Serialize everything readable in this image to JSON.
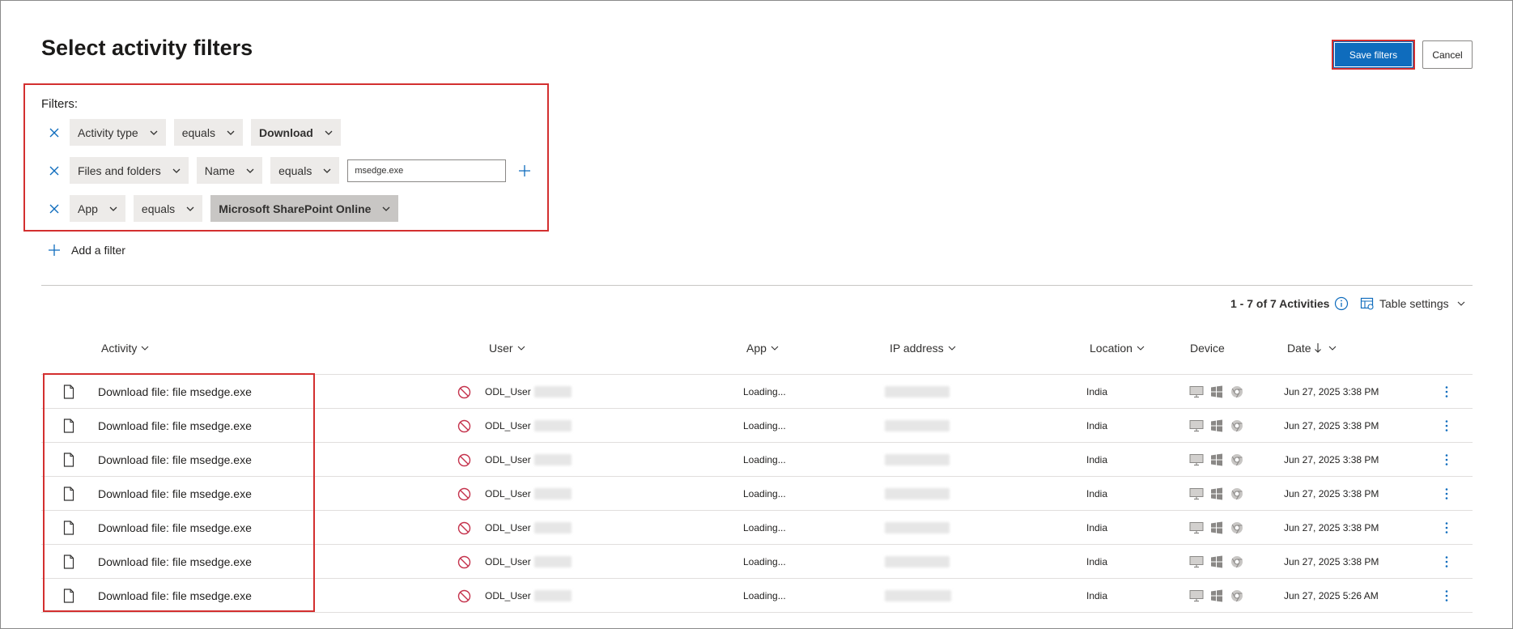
{
  "page": {
    "title": "Select activity filters"
  },
  "actions": {
    "save_label": "Save filters",
    "cancel_label": "Cancel"
  },
  "filters": {
    "label": "Filters:",
    "rows": [
      {
        "parts": [
          "Activity type",
          "equals",
          "Download"
        ]
      },
      {
        "parts": [
          "Files and folders",
          "Name",
          "equals"
        ],
        "input_value": "msedge.exe"
      },
      {
        "parts": [
          "App",
          "equals",
          "Microsoft SharePoint Online"
        ]
      }
    ],
    "add_label": "Add a filter"
  },
  "table": {
    "count_label": "1 - 7 of 7 Activities",
    "settings_label": "Table settings",
    "columns": {
      "activity": "Activity",
      "user": "User",
      "app": "App",
      "ip": "IP address",
      "location": "Location",
      "device": "Device",
      "date": "Date"
    },
    "rows": [
      {
        "activity": "Download file: file msedge.exe",
        "user": "ODL_User",
        "app": "Loading...",
        "location": "India",
        "date": "Jun 27, 2025 3:38 PM"
      },
      {
        "activity": "Download file: file msedge.exe",
        "user": "ODL_User",
        "app": "Loading...",
        "location": "India",
        "date": "Jun 27, 2025 3:38 PM"
      },
      {
        "activity": "Download file: file msedge.exe",
        "user": "ODL_User",
        "app": "Loading...",
        "location": "India",
        "date": "Jun 27, 2025 3:38 PM"
      },
      {
        "activity": "Download file: file msedge.exe",
        "user": "ODL_User",
        "app": "Loading...",
        "location": "India",
        "date": "Jun 27, 2025 3:38 PM"
      },
      {
        "activity": "Download file: file msedge.exe",
        "user": "ODL_User",
        "app": "Loading...",
        "location": "India",
        "date": "Jun 27, 2025 3:38 PM"
      },
      {
        "activity": "Download file: file msedge.exe",
        "user": "ODL_User",
        "app": "Loading...",
        "location": "India",
        "date": "Jun 27, 2025 3:38 PM"
      },
      {
        "activity": "Download file: file msedge.exe",
        "user": "ODL_User",
        "app": "Loading...",
        "location": "India",
        "date": "Jun 27, 2025 5:26 AM"
      }
    ]
  },
  "colors": {
    "accent": "#0f6cbd",
    "highlight_border": "#d32f2f",
    "blocked_icon": "#c4314b"
  },
  "icons": {
    "remove": "close-icon",
    "add": "plus-icon",
    "dropdown": "chevron-down-icon",
    "info": "info-icon",
    "table_settings": "table-settings-icon",
    "file": "file-icon",
    "blocked": "blocked-icon",
    "devices": [
      "desktop-icon",
      "windows-icon",
      "chrome-icon"
    ],
    "more": "more-vertical-icon",
    "sort": "arrow-down-icon"
  }
}
